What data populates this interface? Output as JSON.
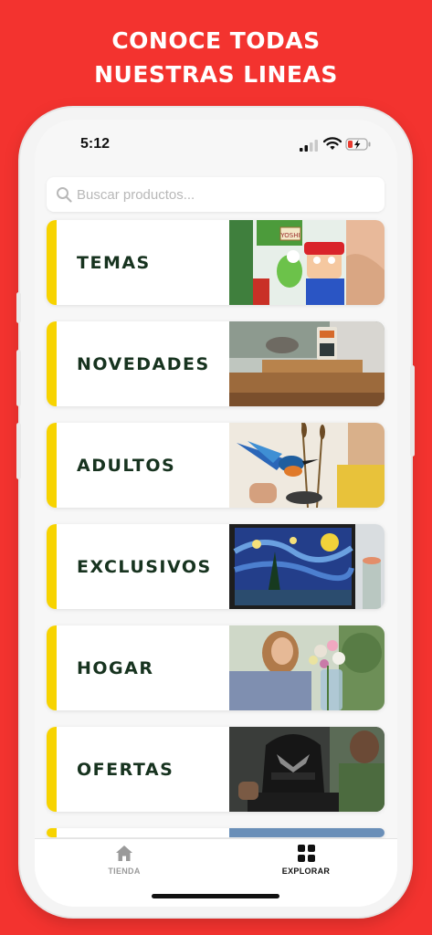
{
  "promo": {
    "headline_line1": "CONOCE TODAS",
    "headline_line2": "NUESTRAS LINEAS"
  },
  "status_bar": {
    "time": "5:12",
    "signal_icon": "signal-icon",
    "wifi_icon": "wifi-icon",
    "battery_icon": "battery-charging-icon"
  },
  "search": {
    "placeholder": "Buscar productos...",
    "value": "",
    "icon": "search-icon"
  },
  "categories": [
    {
      "label": "TEMAS",
      "image": "lego-mario-yoshi-set"
    },
    {
      "label": "NOVEDADES",
      "image": "brick-figure-on-shelf"
    },
    {
      "label": "ADULTOS",
      "image": "kingfisher-bird-build"
    },
    {
      "label": "EXCLUSIVOS",
      "image": "starry-night-mosaic"
    },
    {
      "label": "HOGAR",
      "image": "flower-bouquet-build"
    },
    {
      "label": "OFERTAS",
      "image": "black-panther-bust"
    }
  ],
  "tabbar": {
    "tabs": [
      {
        "label": "TIENDA",
        "icon": "home-icon",
        "active": false
      },
      {
        "label": "EXPLORAR",
        "icon": "grid-icon",
        "active": true
      }
    ]
  },
  "colors": {
    "background": "#f3332f",
    "accent_bar": "#f7d300",
    "label_text": "#17331f",
    "tab_active": "#111111",
    "tab_inactive": "#9a9a9a"
  }
}
